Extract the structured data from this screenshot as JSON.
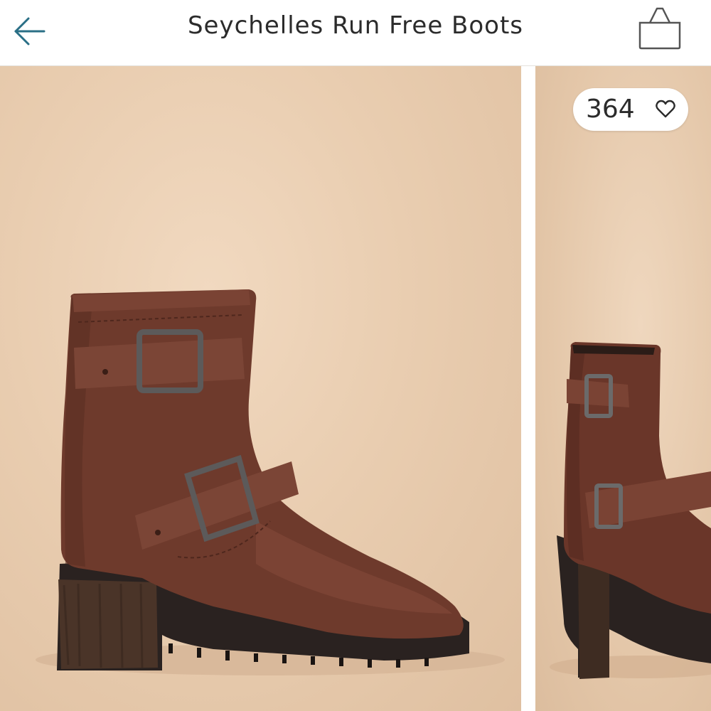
{
  "header": {
    "title": "Seychelles Run Free Boots",
    "back_icon": "arrow-left-icon",
    "bag_icon": "shopping-bag-icon"
  },
  "gallery": {
    "images": [
      {
        "alt": "Seychelles Run Free Boots",
        "active": true
      },
      {
        "alt": "Seychelles Run Free Boots",
        "active": false
      }
    ]
  },
  "likes": {
    "count": "364",
    "icon": "heart-outline-icon"
  },
  "colors": {
    "accent": "#2a6f86",
    "background_beige": "#e9cdb0",
    "boot_brown": "#6e3a2c",
    "sole_dark": "#2a2220"
  }
}
